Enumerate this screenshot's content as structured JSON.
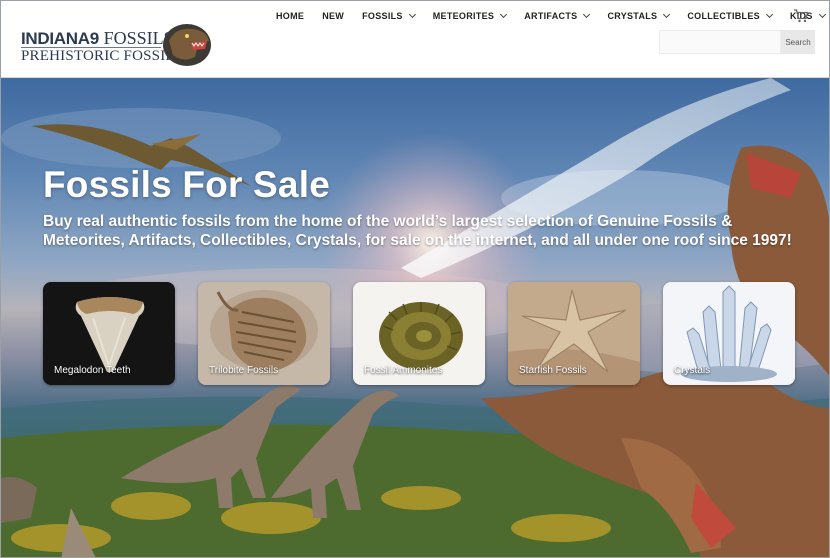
{
  "logo": {
    "brand": "INDIANA9",
    "word": "FOSSILS",
    "tagline": "PREHISTORIC FOSSILS"
  },
  "nav": {
    "items": [
      {
        "label": "HOME",
        "dropdown": false
      },
      {
        "label": "NEW",
        "dropdown": false
      },
      {
        "label": "FOSSILS",
        "dropdown": true
      },
      {
        "label": "METEORITES",
        "dropdown": true
      },
      {
        "label": "ARTIFACTS",
        "dropdown": true
      },
      {
        "label": "CRYSTALS",
        "dropdown": true
      },
      {
        "label": "COLLECTIBLES",
        "dropdown": true
      },
      {
        "label": "KIDS",
        "dropdown": true
      }
    ],
    "cart_icon": "cart-icon"
  },
  "search": {
    "placeholder": "",
    "value": "",
    "button_label": "Search"
  },
  "hero": {
    "title": "Fossils For Sale",
    "subtitle": "Buy real authentic fossils from the home of the world’s largest selection of Genuine Fossils & Meteorites, Artifacts, Collectibles, Crystals, for sale on the internet, and all under one roof since 1997!"
  },
  "categories": [
    {
      "label": "Megalodon Teeth"
    },
    {
      "label": "Trilobite Fossils"
    },
    {
      "label": "Fossil Ammonites"
    },
    {
      "label": "Starfish Fossils"
    },
    {
      "label": "Crystals"
    }
  ],
  "colors": {
    "header_bg": "#ffffff",
    "logo_text": "#2b3a52",
    "nav_text": "#222222",
    "hero_text": "#ffffff"
  }
}
